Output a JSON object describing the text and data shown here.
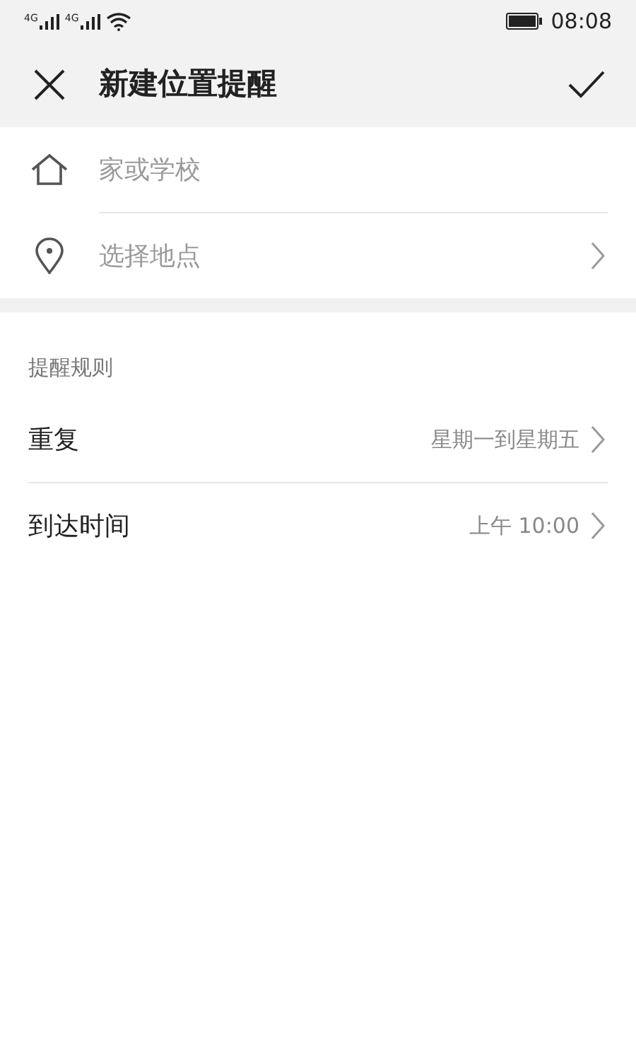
{
  "status_bar": {
    "signals": [
      "4G",
      "4G"
    ],
    "time": "08:08"
  },
  "header": {
    "title": "新建位置提醒"
  },
  "location": {
    "name_field": {
      "placeholder": "家或学校"
    },
    "place_picker": {
      "placeholder": "选择地点"
    }
  },
  "rules": {
    "heading": "提醒规则",
    "items": [
      {
        "label": "重复",
        "value": "星期一到星期五"
      },
      {
        "label": "到达时间",
        "value": "上午 10:00"
      }
    ]
  }
}
